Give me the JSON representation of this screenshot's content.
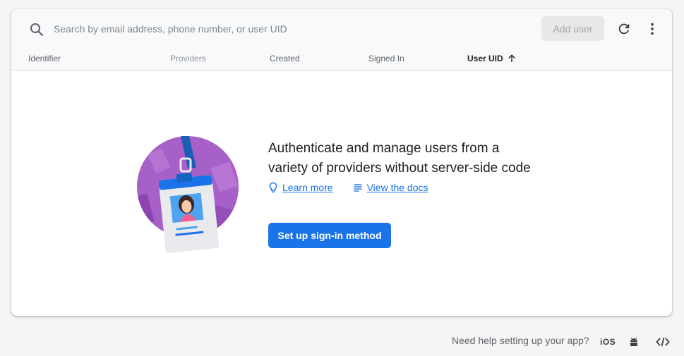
{
  "search": {
    "placeholder": "Search by email address, phone number, or user UID",
    "icon": "search-icon"
  },
  "toolbar": {
    "add_user_label": "Add user",
    "add_user_disabled": true,
    "refresh_icon": "refresh-icon",
    "more_icon": "more-vert-icon"
  },
  "table": {
    "columns": [
      {
        "label": "Identifier",
        "state": "normal"
      },
      {
        "label": "Providers",
        "state": "inactive"
      },
      {
        "label": "Created",
        "state": "normal"
      },
      {
        "label": "Signed In",
        "state": "normal"
      },
      {
        "label": "User UID",
        "state": "sorted-ascending"
      }
    ]
  },
  "empty_state": {
    "headline_line1": "Authenticate and manage users from a",
    "headline_line2": "variety of providers without server-side code",
    "learn_more_label": "Learn more",
    "view_docs_label": "View the docs",
    "setup_button_label": "Set up sign-in method"
  },
  "footer": {
    "help_text": "Need help setting up your app?",
    "ios_label": "iOS",
    "platforms": [
      "ios-icon",
      "android-icon",
      "web-code-icon"
    ]
  },
  "colors": {
    "accent": "#1a73e8",
    "illustration_purple": "#a660c8",
    "background": "#f5f5f5"
  }
}
